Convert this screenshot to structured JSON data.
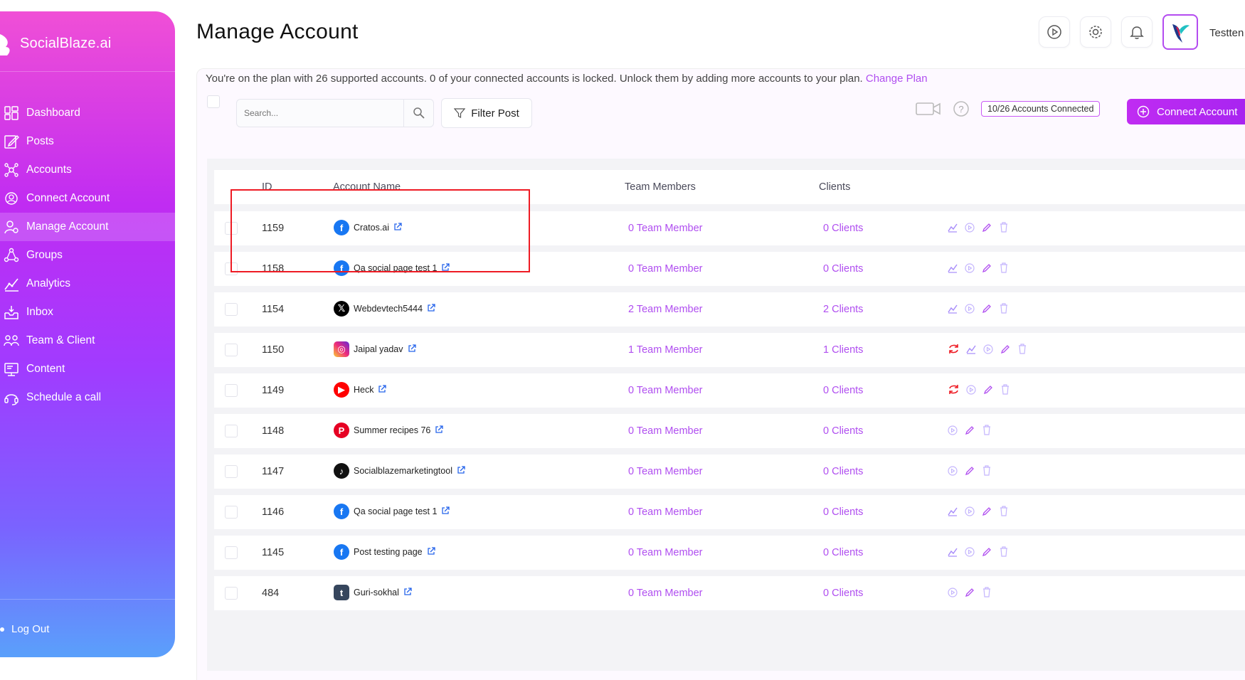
{
  "brand": {
    "name": "SocialBlaze.ai"
  },
  "sidebar": {
    "items": [
      {
        "label": "Dashboard",
        "icon": "dashboard-icon"
      },
      {
        "label": "Posts",
        "icon": "posts-icon"
      },
      {
        "label": "Accounts",
        "icon": "accounts-icon"
      },
      {
        "label": "Connect Account",
        "icon": "connect-account-icon"
      },
      {
        "label": "Manage Account",
        "icon": "manage-account-icon",
        "active": true
      },
      {
        "label": "Groups",
        "icon": "groups-icon"
      },
      {
        "label": "Analytics",
        "icon": "analytics-icon"
      },
      {
        "label": "Inbox",
        "icon": "inbox-icon"
      },
      {
        "label": "Team & Client",
        "icon": "team-icon"
      },
      {
        "label": "Content",
        "icon": "content-icon"
      },
      {
        "label": "Schedule a call",
        "icon": "headset-icon"
      }
    ],
    "logout": "Log Out"
  },
  "header": {
    "title": "Manage Account",
    "username": "Testten"
  },
  "plan": {
    "text": "You're on the plan with 26 supported accounts. 0 of your connected accounts is locked. Unlock them by adding more accounts to your plan.",
    "link": "Change Plan"
  },
  "toolbar": {
    "search_placeholder": "Search...",
    "filter_label": "Filter Post",
    "accounts_connected": "10/26 Accounts Connected",
    "connect_label": "Connect Account"
  },
  "table": {
    "headers": {
      "id": "ID",
      "name": "Account Name",
      "team": "Team Members",
      "clients": "Clients"
    },
    "rows": [
      {
        "id": "1159",
        "name": "Cratos.ai",
        "network": "facebook",
        "team": "0 Team Member",
        "clients": "0 Clients",
        "actions": [
          "analytics",
          "play",
          "edit",
          "delete"
        ]
      },
      {
        "id": "1158",
        "name": "Qa social page test 1",
        "network": "facebook",
        "team": "0 Team Member",
        "clients": "0 Clients",
        "actions": [
          "analytics",
          "play",
          "edit",
          "delete"
        ]
      },
      {
        "id": "1154",
        "name": "Webdevtech5444",
        "network": "x",
        "team": "2 Team Member",
        "clients": "2 Clients",
        "actions": [
          "analytics",
          "play",
          "edit",
          "delete"
        ]
      },
      {
        "id": "1150",
        "name": "Jaipal yadav",
        "network": "instagram",
        "team": "1 Team Member",
        "clients": "1 Clients",
        "actions": [
          "refresh",
          "analytics",
          "play",
          "edit",
          "delete"
        ]
      },
      {
        "id": "1149",
        "name": "Heck",
        "network": "youtube",
        "team": "0 Team Member",
        "clients": "0 Clients",
        "actions": [
          "refresh",
          "play",
          "edit",
          "delete"
        ]
      },
      {
        "id": "1148",
        "name": "Summer recipes 76",
        "network": "pinterest",
        "team": "0 Team Member",
        "clients": "0 Clients",
        "actions": [
          "play",
          "edit",
          "delete"
        ]
      },
      {
        "id": "1147",
        "name": "Socialblazemarketingtool",
        "network": "tiktok",
        "team": "0 Team Member",
        "clients": "0 Clients",
        "actions": [
          "play",
          "edit",
          "delete"
        ]
      },
      {
        "id": "1146",
        "name": "Qa social page test 1",
        "network": "facebook",
        "team": "0 Team Member",
        "clients": "0 Clients",
        "actions": [
          "analytics",
          "play",
          "edit",
          "delete"
        ]
      },
      {
        "id": "1145",
        "name": "Post testing page",
        "network": "facebook",
        "team": "0 Team Member",
        "clients": "0 Clients",
        "actions": [
          "analytics",
          "play",
          "edit",
          "delete"
        ]
      },
      {
        "id": "484",
        "name": "Guri-sokhal",
        "network": "tumblr",
        "team": "0 Team Member",
        "clients": "0 Clients",
        "actions": [
          "play",
          "edit",
          "delete"
        ]
      }
    ]
  },
  "colors": {
    "accent": "#b04ef0",
    "highlight": "#ee1b24",
    "facebook": "#1877f2",
    "youtube": "#ff0000",
    "pinterest": "#e60023",
    "tumblr": "#36465d"
  }
}
